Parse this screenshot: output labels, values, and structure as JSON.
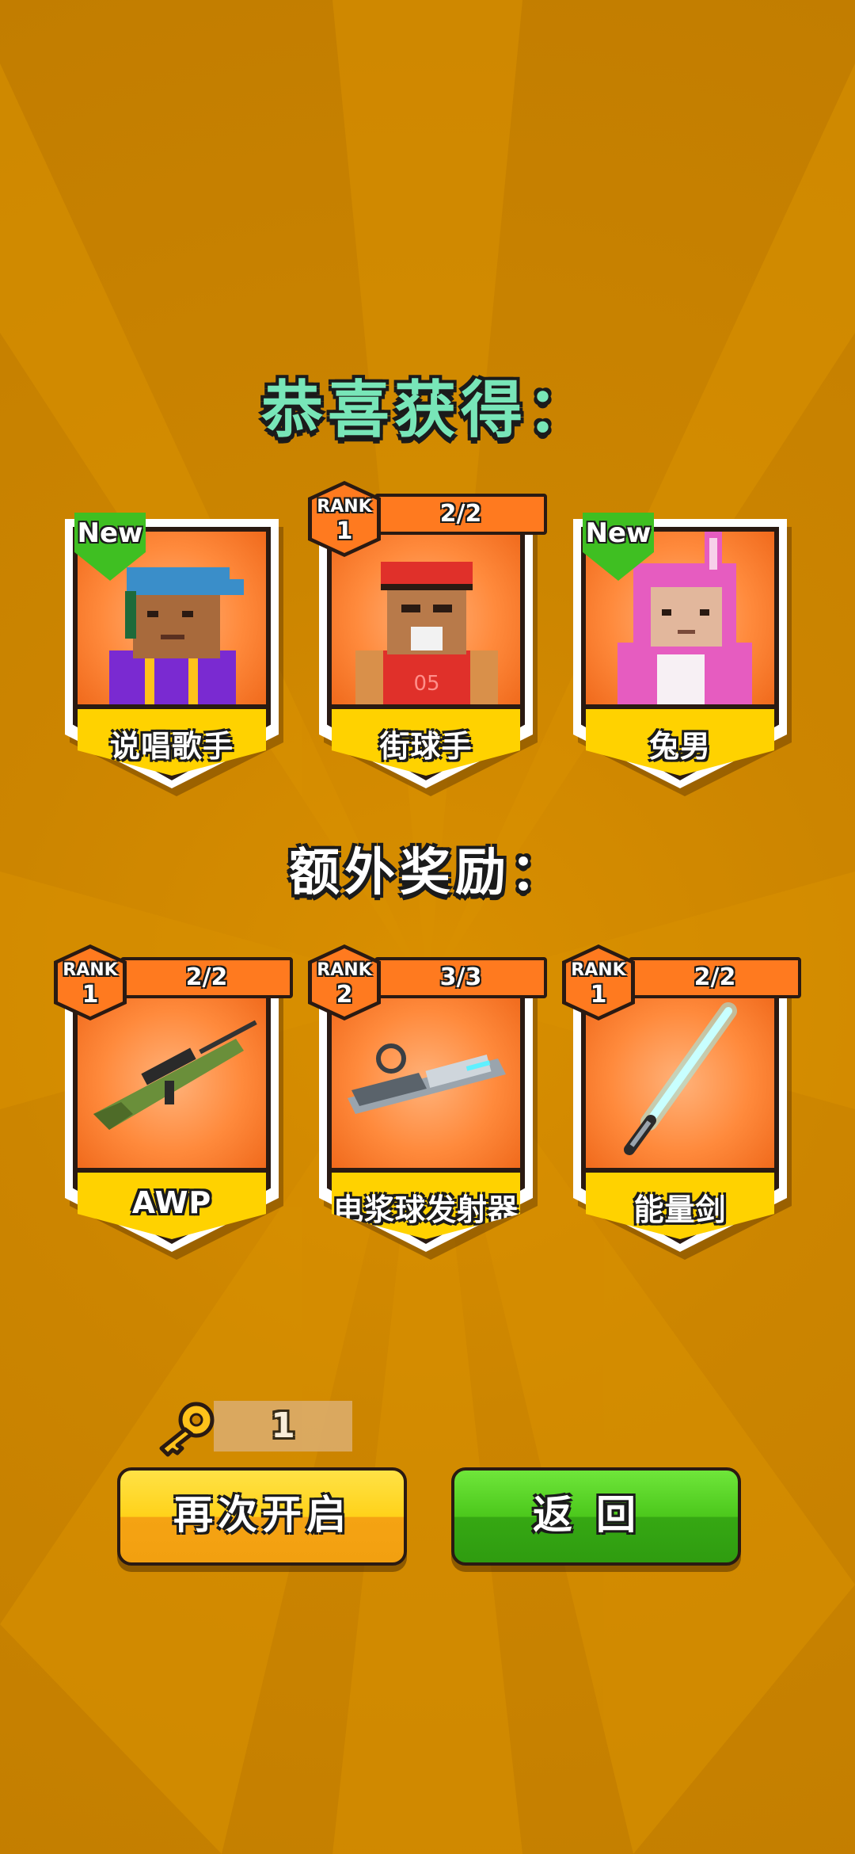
{
  "header": {
    "title": "恭喜获得："
  },
  "rewards": [
    {
      "name": "说唱歌手",
      "is_new": true,
      "new_label": "New",
      "icon": "rapper-character-icon"
    },
    {
      "name": "街球手",
      "is_new": false,
      "rank_label": "RANK",
      "rank": "1",
      "progress": "2/2",
      "icon": "streetball-player-character-icon"
    },
    {
      "name": "兔男",
      "is_new": true,
      "new_label": "New",
      "icon": "bunny-man-character-icon"
    }
  ],
  "bonus": {
    "title": "额外奖励：",
    "items": [
      {
        "name": "AWP",
        "rank_label": "RANK",
        "rank": "1",
        "progress": "2/2",
        "icon": "sniper-rifle-icon"
      },
      {
        "name": "电浆球发射器",
        "rank_label": "RANK",
        "rank": "2",
        "progress": "3/3",
        "icon": "plasma-launcher-icon"
      },
      {
        "name": "能量剑",
        "rank_label": "RANK",
        "rank": "1",
        "progress": "2/2",
        "icon": "energy-sword-icon"
      }
    ]
  },
  "keys": {
    "count": "1",
    "icon": "key-icon"
  },
  "buttons": {
    "open_again": "再次开启",
    "back": "返回"
  },
  "colors": {
    "background": "#cc8500",
    "title_green": "#78e6b8",
    "card_orange": "#ff8a3c",
    "label_yellow": "#ffd200",
    "new_green": "#3fbf22",
    "button_yellow": "#ffd21a",
    "button_green": "#4cc81c"
  }
}
